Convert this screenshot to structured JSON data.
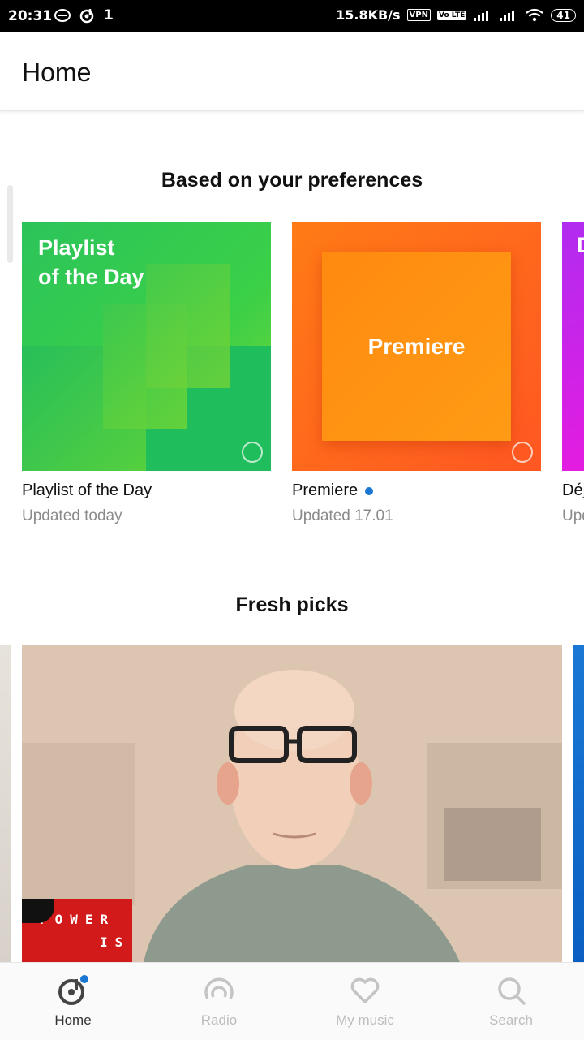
{
  "status_bar": {
    "time": "20:31",
    "sim_indicator": "1",
    "net_speed": "15.8KB/s",
    "vpn": "VPN",
    "volte": "Vo LTE",
    "battery": "41",
    "icons": [
      "notification-icon",
      "music-app-icon",
      "signal-icon",
      "wifi-icon",
      "battery-icon"
    ]
  },
  "appbar": {
    "title": "Home"
  },
  "preferences": {
    "title": "Based on your preferences",
    "cards": [
      {
        "art_text_line1": "Playlist",
        "art_text_line2": "of the Day",
        "name": "Playlist of the Day",
        "sub": "Updated today",
        "new_dot": false
      },
      {
        "art_text": "Premiere",
        "name": "Premiere",
        "sub": "Updated 17.01",
        "new_dot": true
      },
      {
        "art_text": "D",
        "name": "Déj",
        "sub": "Upd"
      }
    ]
  },
  "fresh_picks": {
    "title": "Fresh picks",
    "album_label_line1": "POWER",
    "album_label_line2": "IS"
  },
  "bottom_nav": {
    "items": [
      {
        "label": "Home",
        "icon": "home-music-icon",
        "active": true
      },
      {
        "label": "Radio",
        "icon": "radio-icon",
        "active": false
      },
      {
        "label": "My music",
        "icon": "heart-icon",
        "active": false
      },
      {
        "label": "Search",
        "icon": "search-icon",
        "active": false
      }
    ]
  },
  "colors": {
    "accent": "#1976d2",
    "inactive": "#bdbdbd"
  }
}
